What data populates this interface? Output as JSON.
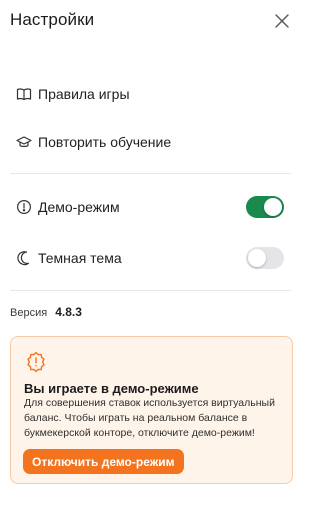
{
  "header": {
    "title": "Настройки",
    "close_icon": "close-icon"
  },
  "menu": {
    "rules": {
      "label": "Правила игры",
      "icon": "book-icon"
    },
    "tutorial": {
      "label": "Повторить обучение",
      "icon": "graduation-cap-icon"
    }
  },
  "toggles": {
    "demo": {
      "label": "Демо-режим",
      "icon": "alert-circle-icon",
      "on": true
    },
    "dark": {
      "label": "Темная тема",
      "icon": "moon-icon",
      "on": false
    }
  },
  "version": {
    "label": "Версия",
    "value": "4.8.3"
  },
  "demo_card": {
    "icon": "warning-badge-icon",
    "title": "Вы играете в демо-режиме",
    "text": "Для совершения ставок используется виртуальный баланс. Чтобы играть на реальном балансе в букмекерской конторе, отключите демо-режим!",
    "button_label": "Отключить демо-режим"
  },
  "colors": {
    "accent_orange": "#f4731f",
    "toggle_on": "#1a8a4c",
    "toggle_off": "#e3e5e8",
    "card_bg": "#fff4ea",
    "card_border": "#f7c9a6"
  }
}
